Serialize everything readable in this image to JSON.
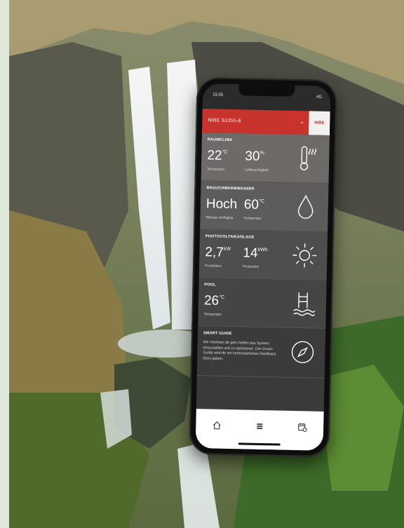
{
  "status": {
    "time": "15:55",
    "signal": "4G"
  },
  "header": {
    "title": "NIBE S1255-6",
    "logo": "NIBE"
  },
  "cards": {
    "room": {
      "title": "RAUMKLIMA",
      "v1": "22",
      "u1": "°C",
      "l1": "Temperatur",
      "v2": "30",
      "u2": "%",
      "l2": "Luftfeuchtigkeit",
      "icon": "thermometer-icon"
    },
    "water": {
      "title": "BRAUCHWARMWASSER",
      "v1": "Hoch",
      "l1": "Wasser verfügbar",
      "v2": "60",
      "u2": "°C",
      "l2": "Temperatur",
      "icon": "water-drop-icon"
    },
    "pv": {
      "title": "PHOTOVOLTAIKANLAGE",
      "v1": "2,7",
      "u1": "kW",
      "l1": "Produktion",
      "v2": "14",
      "u2": "kWh",
      "l2": "Produziert",
      "icon": "sun-icon"
    },
    "pool": {
      "title": "POOL",
      "v1": "26",
      "u1": "°C",
      "l1": "Temperatur",
      "icon": "pool-ladder-icon"
    },
    "guide": {
      "title": "SMART GUIDE",
      "text": "Wir möchten dir gern helfen das System einzustellen und zu optimieren. Der Smart-Guide wird dir ein kontinuierliches Feedback dazu geben.",
      "icon": "compass-icon"
    }
  },
  "nav": {
    "items": [
      "home-icon",
      "menu-icon",
      "calendar-clock-icon"
    ]
  },
  "colors": {
    "brand_red": "#c8332d"
  }
}
